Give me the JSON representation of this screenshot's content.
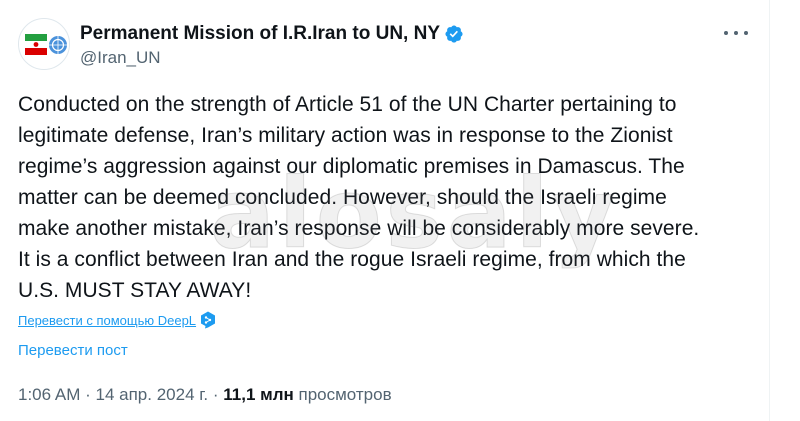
{
  "tweet": {
    "display_name": "Permanent Mission of I.R.Iran to UN, NY",
    "handle": "@Iran_UN",
    "verified": true,
    "body": "Conducted on the strength of Article 51 of the UN Charter pertaining to\nlegitimate defense, Iran’s military action was in response to the Zionist\nregime’s aggression against our diplomatic premises in Damascus. The\nmatter can be deemed concluded. However, should the Israeli regime\nmake another mistake, Iran’s response will be considerably more severe.\nIt is a conflict between Iran and the rogue Israeli regime, from which the\nU.S. MUST STAY AWAY!",
    "translate_deepl_label": "Перевести с помощью DeepL",
    "translate_post_label": "Перевести пост",
    "time": "1:06 AM",
    "separator": "·",
    "date": "14 апр. 2024 г.",
    "views_count": "11,1 млн",
    "views_label": "просмотров"
  },
  "watermark_text": "alosaly",
  "icons": {
    "avatar": "flag-avatar-icon",
    "verified": "verified-badge-icon",
    "more": "more-options-icon",
    "deepl": "deepl-icon"
  },
  "colors": {
    "link": "#1d9bf0",
    "secondary_text": "#536471",
    "primary_text": "#0f1419",
    "verified": "#1d9bf0"
  }
}
